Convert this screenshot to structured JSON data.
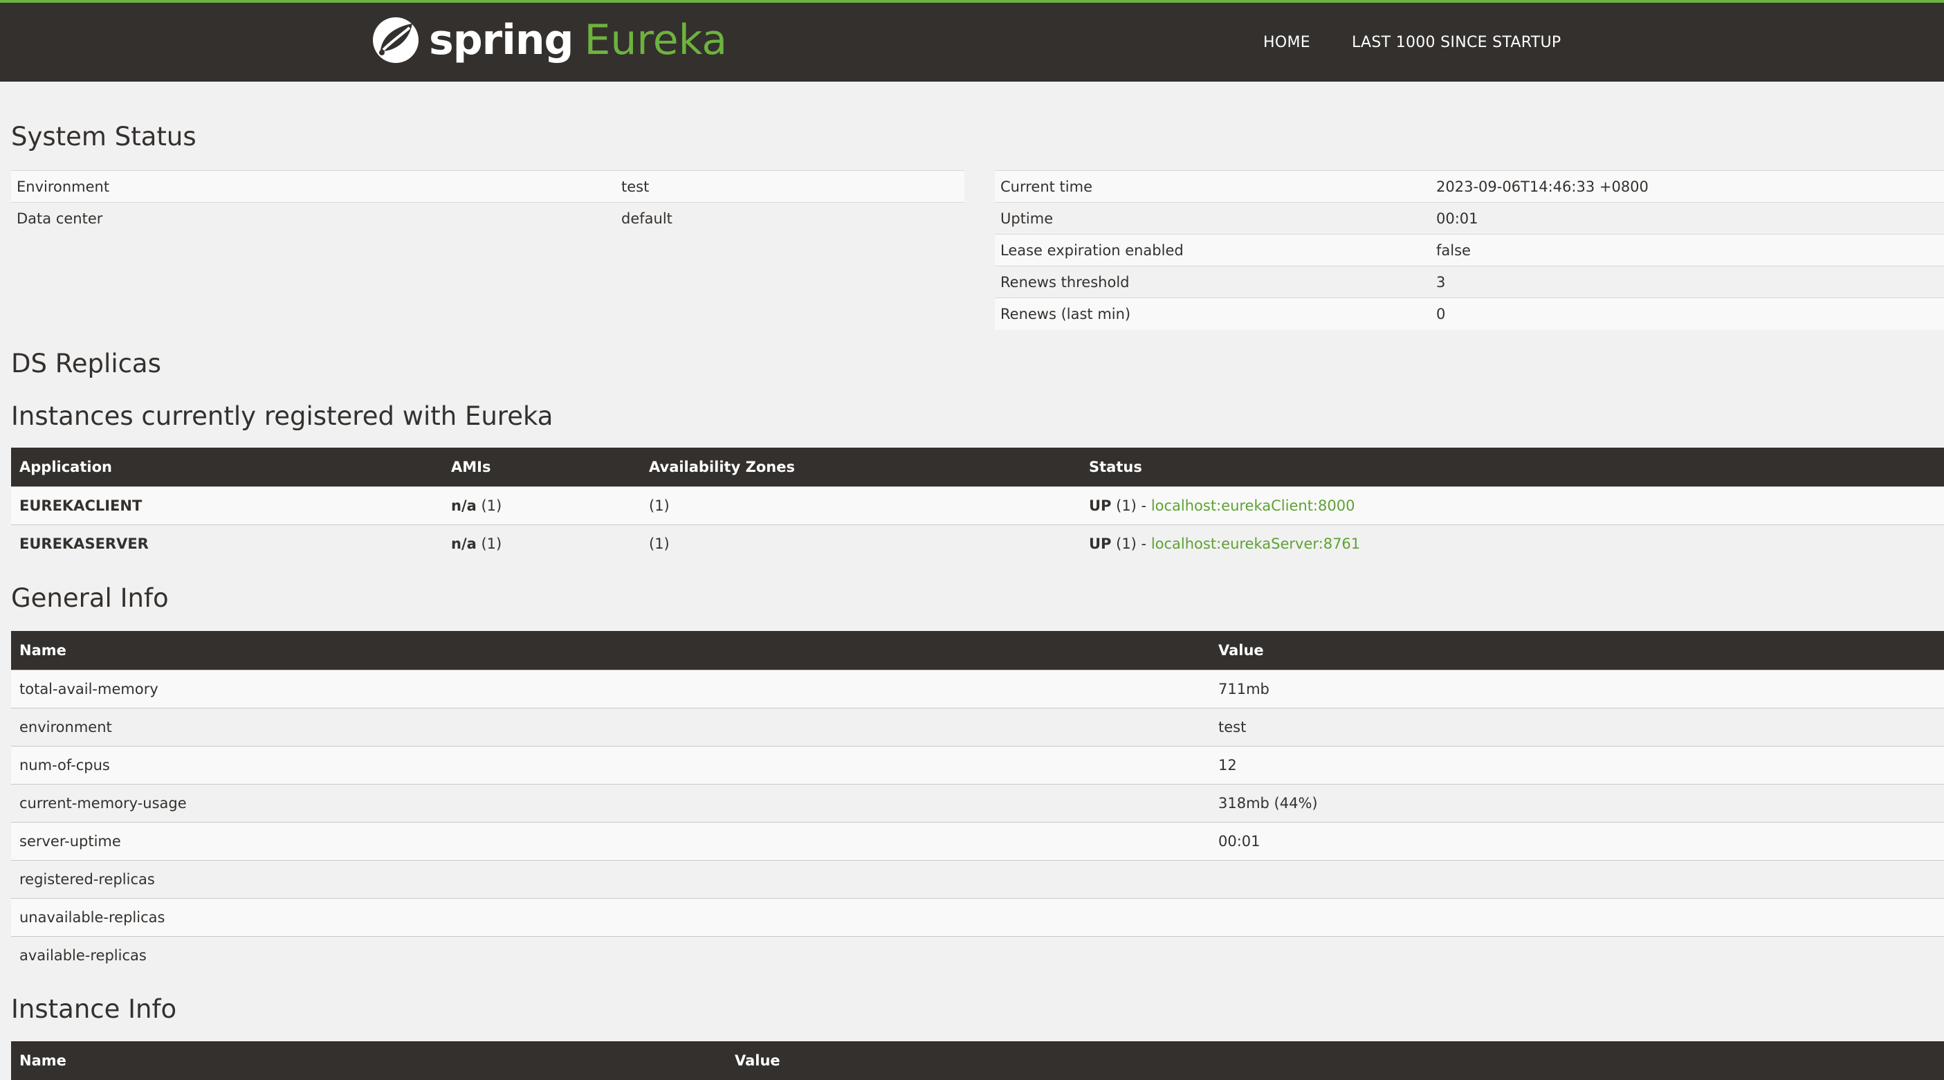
{
  "brand": {
    "spring": "spring",
    "eureka": "Eureka"
  },
  "nav": {
    "home": "HOME",
    "last1000": "LAST 1000 SINCE STARTUP"
  },
  "colors": {
    "accent": "#6db33f",
    "header_bg": "#34302d",
    "page_bg": "#f1f1f1",
    "link": "#5fa134"
  },
  "system_status": {
    "title": "System Status",
    "left": [
      {
        "k": "Environment",
        "v": "test"
      },
      {
        "k": "Data center",
        "v": "default"
      }
    ],
    "right": [
      {
        "k": "Current time",
        "v": "2023-09-06T14:46:33 +0800"
      },
      {
        "k": "Uptime",
        "v": "00:01"
      },
      {
        "k": "Lease expiration enabled",
        "v": "false"
      },
      {
        "k": "Renews threshold",
        "v": "3"
      },
      {
        "k": "Renews (last min)",
        "v": "0"
      }
    ]
  },
  "ds_replicas": {
    "title": "DS Replicas"
  },
  "instances": {
    "title": "Instances currently registered with Eureka",
    "headers": [
      "Application",
      "AMIs",
      "Availability Zones",
      "Status"
    ],
    "rows": [
      {
        "app": "EUREKACLIENT",
        "ami_bold": "n/a",
        "ami_count": " (1)",
        "zones": "(1)",
        "status_bold": "UP",
        "status_count": " (1) - ",
        "link": "localhost:eurekaClient:8000"
      },
      {
        "app": "EUREKASERVER",
        "ami_bold": "n/a",
        "ami_count": " (1)",
        "zones": "(1)",
        "status_bold": "UP",
        "status_count": " (1) - ",
        "link": "localhost:eurekaServer:8761"
      }
    ]
  },
  "general_info": {
    "title": "General Info",
    "headers": [
      "Name",
      "Value"
    ],
    "rows": [
      {
        "k": "total-avail-memory",
        "v": "711mb"
      },
      {
        "k": "environment",
        "v": "test"
      },
      {
        "k": "num-of-cpus",
        "v": "12"
      },
      {
        "k": "current-memory-usage",
        "v": "318mb (44%)"
      },
      {
        "k": "server-uptime",
        "v": "00:01"
      },
      {
        "k": "registered-replicas",
        "v": ""
      },
      {
        "k": "unavailable-replicas",
        "v": ""
      },
      {
        "k": "available-replicas",
        "v": ""
      }
    ]
  },
  "instance_info": {
    "title": "Instance Info",
    "headers": [
      "Name",
      "Value"
    ]
  }
}
